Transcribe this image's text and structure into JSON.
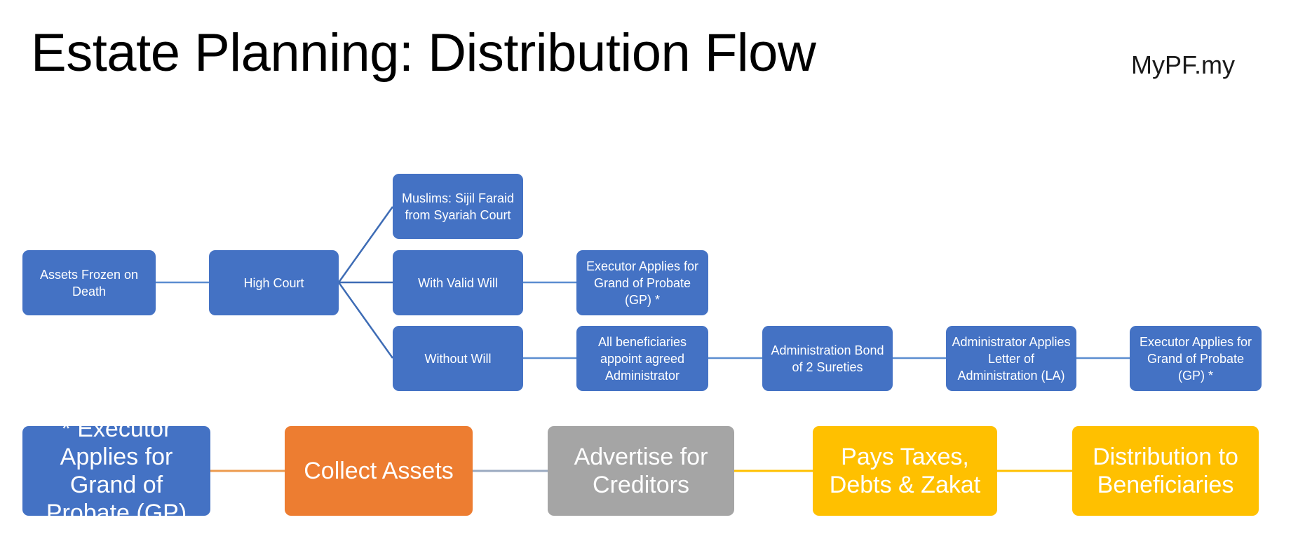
{
  "header": {
    "title": "Estate Planning: Distribution Flow",
    "brand": "MyPF.my"
  },
  "colors": {
    "blue": "#4472C4",
    "orange": "#ED7D31",
    "gray": "#A5A5A5",
    "amber": "#FFC000",
    "connector_blue": "#5B8DD0",
    "connector_orange": "#ED9B4E",
    "connector_amber": "#FFC000",
    "connector_gray": "#9BAAC0",
    "text_on_fill": "#FFFFFF",
    "title_text": "#000000",
    "background": "#FFFFFF"
  },
  "flow": {
    "top_section": {
      "start": {
        "label": "Assets Frozen on Death"
      },
      "court": {
        "label": "High Court"
      },
      "branches": [
        {
          "label": "Muslims: Sijil Faraid from Syariah Court"
        },
        {
          "label": "With Valid Will"
        },
        {
          "label": "Without Will"
        }
      ],
      "will_chain": [
        {
          "label": "Executor Applies for Grand of Probate (GP) *"
        }
      ],
      "intestate_chain": [
        {
          "label": "All beneficiaries appoint agreed Administrator"
        },
        {
          "label": "Administration Bond of 2 Sureties"
        },
        {
          "label": "Administrator Applies Letter of Administration (LA)"
        },
        {
          "label": "Executor Applies for Grand of Probate (GP) *"
        }
      ]
    },
    "bottom_section": [
      {
        "label": "* Executor Applies for Grand of Probate (GP)",
        "color": "blue"
      },
      {
        "label": "Collect Assets",
        "color": "orange"
      },
      {
        "label": "Advertise for Creditors",
        "color": "gray"
      },
      {
        "label": "Pays Taxes, Debts & Zakat",
        "color": "amber"
      },
      {
        "label": "Distribution to Beneficiaries",
        "color": "amber"
      }
    ]
  }
}
